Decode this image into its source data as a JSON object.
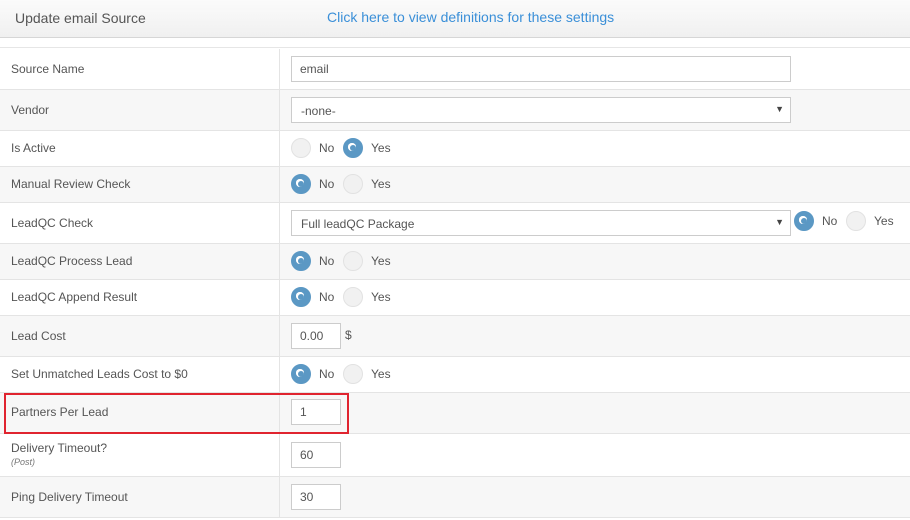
{
  "header": {
    "title": "Update email Source",
    "definitions_link": "Click here to view definitions for these settings"
  },
  "fields": {
    "source_name": {
      "label": "Source Name",
      "value": "email"
    },
    "vendor": {
      "label": "Vendor",
      "value": "-none-"
    },
    "is_active": {
      "label": "Is Active",
      "no": "No",
      "yes": "Yes",
      "selected": "Yes"
    },
    "manual_review": {
      "label": "Manual Review Check",
      "no": "No",
      "yes": "Yes",
      "selected": "No"
    },
    "leadqc_check": {
      "label": "LeadQC Check",
      "value": "Full leadQC Package",
      "no": "No",
      "yes": "Yes",
      "selected": "No"
    },
    "leadqc_process": {
      "label": "LeadQC Process Lead",
      "no": "No",
      "yes": "Yes",
      "selected": "No"
    },
    "leadqc_append": {
      "label": "LeadQC Append Result",
      "no": "No",
      "yes": "Yes",
      "selected": "No"
    },
    "lead_cost": {
      "label": "Lead Cost",
      "value": "0.00",
      "unit": "$"
    },
    "unmatched_cost": {
      "label": "Set Unmatched Leads Cost to $0",
      "no": "No",
      "yes": "Yes",
      "selected": "No"
    },
    "partners_per_lead": {
      "label": "Partners Per Lead",
      "value": "1"
    },
    "delivery_timeout": {
      "label": "Delivery Timeout?",
      "sublabel": "(Post)",
      "value": "60"
    },
    "ping_timeout": {
      "label": "Ping Delivery Timeout",
      "value": "30"
    }
  },
  "colors": {
    "accent": "#5b98c4",
    "link": "#3a8fd8",
    "highlight": "#e0242f"
  },
  "icons": {
    "select_arrow": "caret-down-icon"
  }
}
